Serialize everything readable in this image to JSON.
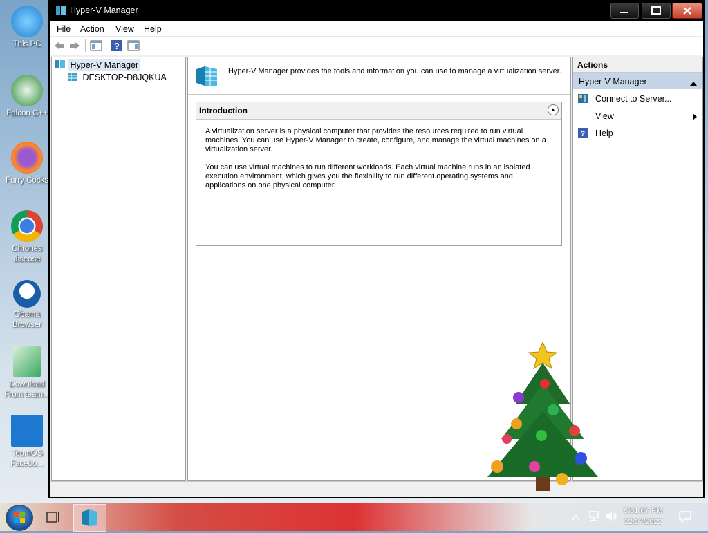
{
  "desktop": {
    "icons": [
      {
        "label": "This PC"
      },
      {
        "label": "Falcon C++"
      },
      {
        "label": "Furry Cocks"
      },
      {
        "label": "Chrones disease"
      },
      {
        "label": "Obama Browser"
      },
      {
        "label": "Download From team..."
      },
      {
        "label": "TeamOS Facebo..."
      }
    ]
  },
  "window": {
    "title": "Hyper-V Manager",
    "menu": [
      "File",
      "Action",
      "View",
      "Help"
    ]
  },
  "tree": {
    "root": "Hyper-V Manager",
    "child": "DESKTOP-D8JQKUA"
  },
  "center": {
    "banner_text": "Hyper-V Manager provides the tools and information you can use to manage a virtualization server.",
    "intro_title": "Introduction",
    "intro_p1": "A virtualization server is a physical computer that provides the resources required to run virtual machines. You can use Hyper-V Manager to create, configure, and manage the virtual machines on a virtualization server.",
    "intro_p2": "You can use virtual machines to run different workloads. Each virtual machine runs in an isolated execution environment, which gives you the flexibility to run different operating systems and applications on one physical computer."
  },
  "actions": {
    "header": "Actions",
    "section": "Hyper-V Manager",
    "items": [
      "Connect to Server...",
      "View",
      "Help"
    ]
  },
  "taskbar": {
    "time": "8:51:07 PM",
    "date": "12/17/2022"
  },
  "colors": {
    "selection": "#dde8f5",
    "actions_section": "#c5d5e8",
    "close_button": "#c4402a"
  }
}
